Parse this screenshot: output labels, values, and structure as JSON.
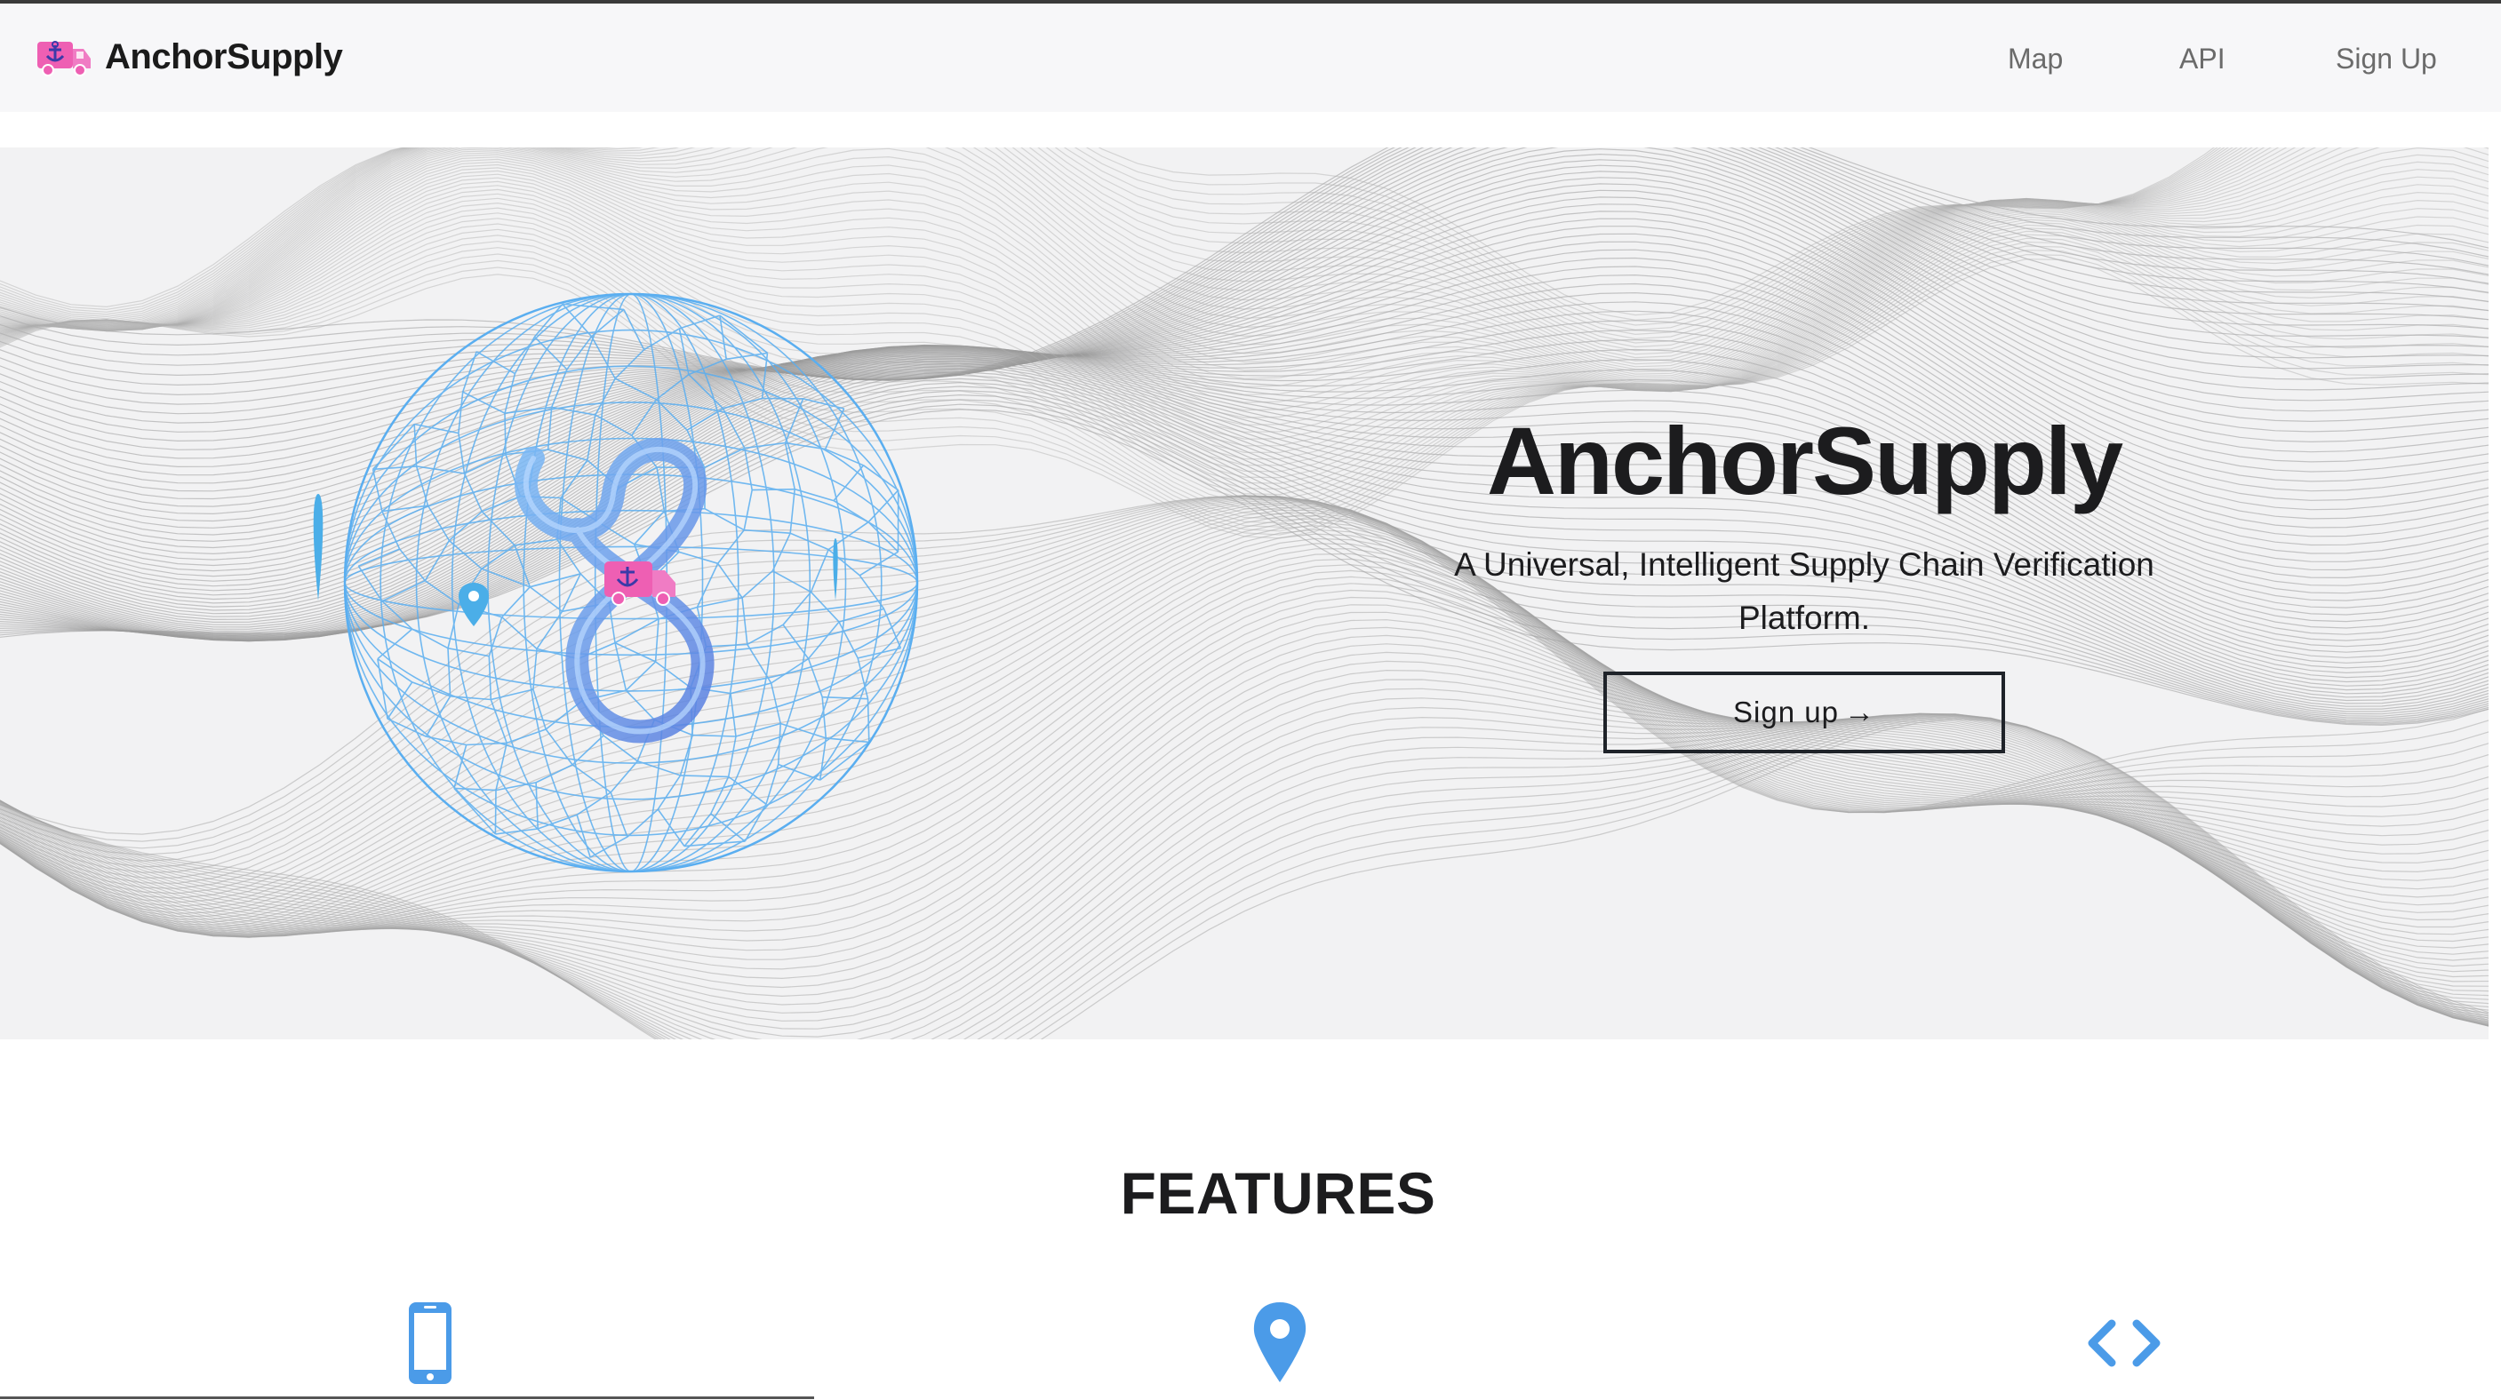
{
  "navbar": {
    "brand_name": "AnchorSupply",
    "links": [
      {
        "label": "Map"
      },
      {
        "label": "API"
      },
      {
        "label": "Sign Up"
      }
    ]
  },
  "hero": {
    "title": "AnchorSupply",
    "subtitle": "A Universal, Intelligent Supply Chain Verification Platform.",
    "button_label": "Sign up",
    "button_arrow": "→"
  },
  "features": {
    "title": "FEATURES",
    "icons": [
      "mobile-phone-icon",
      "map-pin-icon",
      "code-icon"
    ]
  },
  "colors": {
    "accent_blue": "#4b9be8",
    "logo_pink": "#ee5fb3",
    "text_dark": "#1c1c1e",
    "nav_text": "#6b6b6b"
  }
}
